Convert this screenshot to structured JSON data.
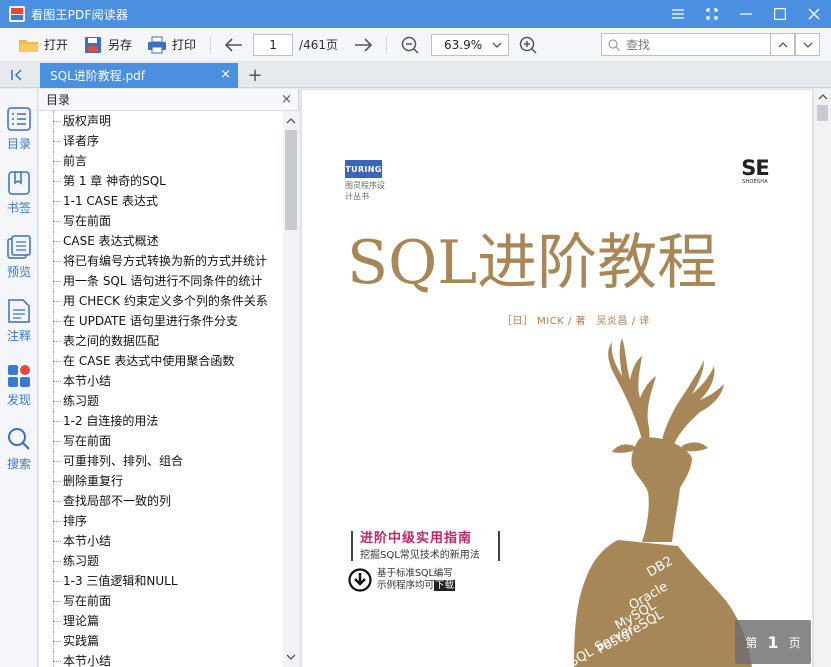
{
  "window": {
    "title": "看图王PDF阅读器"
  },
  "toolbar": {
    "open_label": "打开",
    "save_as_label": "另存",
    "print_label": "打印",
    "current_page": "1",
    "total_pages": "/461页",
    "zoom": "63.9%",
    "search_placeholder": "查找"
  },
  "tabs": {
    "active_tab": "SQL进阶教程.pdf",
    "close_glyph": "×",
    "new_tab_glyph": "+"
  },
  "rail": {
    "items": [
      {
        "label": "目录",
        "icon": "outline-icon"
      },
      {
        "label": "书签",
        "icon": "bookmark-icon"
      },
      {
        "label": "预览",
        "icon": "preview-icon"
      },
      {
        "label": "注释",
        "icon": "annotation-icon"
      },
      {
        "label": "发现",
        "icon": "discover-icon"
      },
      {
        "label": "搜索",
        "icon": "search-icon"
      }
    ]
  },
  "outline": {
    "title": "目录",
    "close_glyph": "×",
    "items": [
      "版权声明",
      "译者序",
      "前言",
      "第 1 章 神奇的SQL",
      "1-1 CASE 表达式",
      "写在前面",
      "CASE 表达式概述",
      "将已有编号方式转换为新的方式并统计",
      "用一条 SQL 语句进行不同条件的统计",
      "用 CHECK 约束定义多个列的条件关系",
      "在 UPDATE 语句里进行条件分支",
      "表之间的数据匹配",
      "在 CASE 表达式中使用聚合函数",
      "本节小结",
      "练习题",
      "1-2 自连接的用法",
      "写在前面",
      "可重排列、排列、组合",
      "删除重复行",
      "查找局部不一致的列",
      "排序",
      "本节小结",
      "练习题",
      "1-3 三值逻辑和NULL",
      "写在前面",
      "理论篇",
      "实践篇",
      "本节小结"
    ]
  },
  "cover": {
    "publisher_logo": "TURING",
    "series": "图灵程序设计丛书",
    "imprint_logo": "SE",
    "imprint_sub": "SHOESHA",
    "book_title": "SQL进阶教程",
    "authors": "［日］ MICK / 著　吴炎昌 / 译",
    "tagline": "进阶中级实用指南",
    "subtitle": "挖掘SQL常见技术的新用法",
    "download_line1": "基于标准SQL编写",
    "download_line2": "示例程序均可",
    "download_word": "下载",
    "databases": [
      "DB2",
      "Oracle",
      "MySQL",
      "PostgreSQL",
      "SQL Server"
    ]
  },
  "page_indicator": {
    "prefix": "第",
    "page": "1",
    "suffix": "页"
  },
  "colors": {
    "accent": "#4a8fe0",
    "title_gold": "#a78758",
    "tagline_magenta": "#c1266b"
  }
}
